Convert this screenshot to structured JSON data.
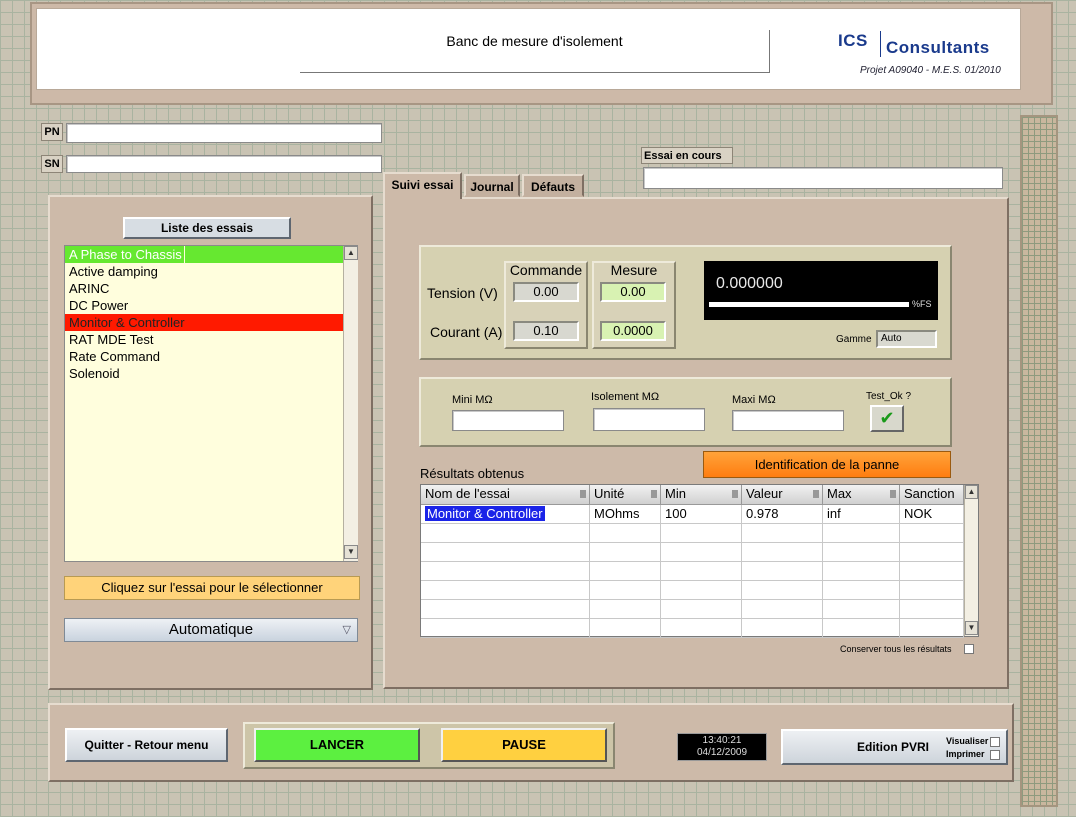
{
  "header": {
    "title": "Banc de mesure d'isolement",
    "logo_ics": "ICS",
    "logo_consultants": "Consultants",
    "projet": "Projet A09040 - M.E.S. 01/2010"
  },
  "identification": {
    "pn_label": "PN",
    "pn_value": "",
    "sn_label": "SN",
    "sn_value": ""
  },
  "essai_en_cours": {
    "label": "Essai en cours",
    "value": ""
  },
  "tabs": [
    {
      "label": "Suivi essai",
      "active": true
    },
    {
      "label": "Journal",
      "active": false
    },
    {
      "label": "Défauts",
      "active": false
    }
  ],
  "left_panel": {
    "list_title": "Liste des essais",
    "items": [
      {
        "label": "A Phase to Chassis",
        "state": "selected"
      },
      {
        "label": "Active damping",
        "state": "normal"
      },
      {
        "label": "ARINC",
        "state": "normal"
      },
      {
        "label": "DC Power",
        "state": "normal"
      },
      {
        "label": "Monitor & Controller",
        "state": "failed"
      },
      {
        "label": "RAT MDE Test",
        "state": "normal"
      },
      {
        "label": "Rate Command",
        "state": "normal"
      },
      {
        "label": "Solenoid",
        "state": "normal"
      }
    ],
    "hint": "Cliquez sur l'essai pour le sélectionner",
    "mode_value": "Automatique"
  },
  "measure": {
    "commande_header": "Commande",
    "mesure_header": "Mesure",
    "tension_label": "Tension (V)",
    "courant_label": "Courant (A)",
    "tension_commande": "0.00",
    "tension_mesure": "0.00",
    "courant_commande": "0.10",
    "courant_mesure": "0.0000",
    "display_value": "0.000000",
    "display_unit": "%FS",
    "display_level": 1.0,
    "gamme_label": "Gamme",
    "gamme_value": "Auto"
  },
  "limits": {
    "mini_label": "Mini MΩ",
    "isolement_label": "Isolement MΩ",
    "maxi_label": "Maxi MΩ",
    "test_ok_label": "Test_Ok ?",
    "mini_value": "",
    "isolement_value": "",
    "maxi_value": "",
    "test_ok_checked": true
  },
  "identification_button": "Identification de la panne",
  "results": {
    "title": "Résultats obtenus",
    "columns": [
      "Nom de l'essai",
      "Unité",
      "Min",
      "Valeur",
      "Max",
      "Sanction"
    ],
    "rows": [
      [
        "Monitor & Controller",
        "MOhms",
        "100",
        "0.978",
        "inf",
        "NOK"
      ]
    ],
    "empty_rows": 6,
    "conserver_label": "Conserver tous les résultats"
  },
  "footer": {
    "quit_label": "Quitter - Retour menu",
    "lancer_label": "LANCER",
    "pause_label": "PAUSE",
    "time": "13:40:21",
    "date": "04/12/2009",
    "edition_label": "Edition PVRI",
    "visualiser_label": "Visualiser",
    "imprimer_label": "Imprimer"
  },
  "colors": {
    "selected_green": "#66e830",
    "failed_red": "#ff1a00",
    "lancer_green": "#5cf040",
    "pause_yellow": "#ffd040",
    "ident_orange": "#ff8c1a",
    "hint_yellow": "#ffd37a"
  }
}
